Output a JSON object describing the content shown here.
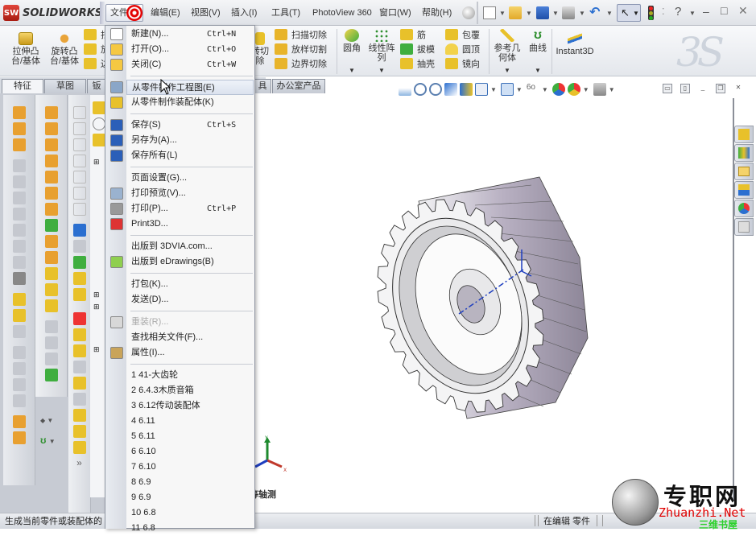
{
  "app": {
    "title": "SOLIDWORKS",
    "logo_badge": "SW"
  },
  "menubar": {
    "items": [
      {
        "id": "file",
        "label": "文件(F)"
      },
      {
        "id": "edit",
        "label": "编辑(E)"
      },
      {
        "id": "view",
        "label": "视图(V)"
      },
      {
        "id": "insert",
        "label": "插入(I)"
      },
      {
        "id": "tools",
        "label": "工具(T)"
      },
      {
        "id": "photoview",
        "label": "PhotoView 360"
      },
      {
        "id": "window",
        "label": "窗口(W)"
      },
      {
        "id": "help",
        "label": "帮助(H)"
      }
    ]
  },
  "quick_toolbar": {
    "icons": [
      "pin-icon",
      "new-document-icon",
      "open-folder-icon",
      "save-icon",
      "print-icon",
      "undo-icon",
      "select-arrow-icon",
      "rebuild-traffic-light-icon",
      "options-icon",
      "help-icon"
    ],
    "window_controls": {
      "minimize": "–",
      "maximize": "□",
      "close": "✕"
    }
  },
  "command_manager": {
    "large_buttons": [
      {
        "label_line1": "拉伸凸",
        "label_line2": "台/基体"
      },
      {
        "label_line1": "旋转凸",
        "label_line2": "台/基体"
      }
    ],
    "small_left": [
      "扫描",
      "放样",
      "边界"
    ],
    "cut_partial": {
      "line1": "转切",
      "line2": "除"
    },
    "cut_group": [
      "扫描切除",
      "放样切割",
      "边界切除"
    ],
    "fillet": "圆角",
    "linear_pattern": {
      "line1": "线性阵",
      "line2": "列"
    },
    "features_a": [
      "筋",
      "拔模",
      "抽壳"
    ],
    "features_b": [
      "包覆",
      "圆顶",
      "镜向"
    ],
    "ref_geometry": {
      "line1": "参考几",
      "line2": "何体"
    },
    "curves": "曲线",
    "instant3d": "Instant3D"
  },
  "tabs": [
    {
      "label": "特征",
      "active": true
    },
    {
      "label": "草图",
      "active": false
    },
    {
      "label": "钣",
      "active": false
    },
    {
      "label": "具",
      "active": false
    },
    {
      "label": "办公室产品",
      "active": false
    }
  ],
  "file_menu": {
    "items": [
      {
        "type": "item",
        "label": "新建(N)...",
        "shortcut": "Ctrl+N",
        "icon": "new-document-icon"
      },
      {
        "type": "item",
        "label": "打开(O)...",
        "shortcut": "Ctrl+O",
        "icon": "open-folder-icon"
      },
      {
        "type": "item",
        "label": "关闭(C)",
        "shortcut": "Ctrl+W",
        "icon": "close-folder-icon"
      },
      {
        "type": "sep"
      },
      {
        "type": "item",
        "label": "从零件制作工程图(E)",
        "shortcut": "",
        "icon": "make-drawing-icon",
        "highlighted": true
      },
      {
        "type": "item",
        "label": "从零件制作装配体(K)",
        "shortcut": "",
        "icon": "make-assembly-icon"
      },
      {
        "type": "sep"
      },
      {
        "type": "item",
        "label": "保存(S)",
        "shortcut": "Ctrl+S",
        "icon": "save-icon"
      },
      {
        "type": "item",
        "label": "另存为(A)...",
        "shortcut": "",
        "icon": "save-as-icon"
      },
      {
        "type": "item",
        "label": "保存所有(L)",
        "shortcut": "",
        "icon": "save-all-icon"
      },
      {
        "type": "sep"
      },
      {
        "type": "item",
        "label": "页面设置(G)...",
        "shortcut": "",
        "icon": ""
      },
      {
        "type": "item",
        "label": "打印预览(V)...",
        "shortcut": "",
        "icon": "print-preview-icon"
      },
      {
        "type": "item",
        "label": "打印(P)...",
        "shortcut": "Ctrl+P",
        "icon": "print-icon"
      },
      {
        "type": "item",
        "label": "Print3D...",
        "shortcut": "",
        "icon": "print3d-icon"
      },
      {
        "type": "sep"
      },
      {
        "type": "item",
        "label": "出版到 3DVIA.com...",
        "shortcut": "",
        "icon": ""
      },
      {
        "type": "item",
        "label": "出版到 eDrawings(B)",
        "shortcut": "",
        "icon": "edrawings-icon"
      },
      {
        "type": "sep"
      },
      {
        "type": "item",
        "label": "打包(K)...",
        "shortcut": "",
        "icon": ""
      },
      {
        "type": "item",
        "label": "发送(D)...",
        "shortcut": "",
        "icon": ""
      },
      {
        "type": "sep"
      },
      {
        "type": "item",
        "label": "重装(R)...",
        "shortcut": "",
        "icon": "reload-icon",
        "disabled": true
      },
      {
        "type": "item",
        "label": "查找相关文件(F)...",
        "shortcut": "",
        "icon": ""
      },
      {
        "type": "item",
        "label": "属性(I)...",
        "shortcut": "",
        "icon": "properties-icon"
      },
      {
        "type": "sep"
      },
      {
        "type": "item",
        "label": "1 41-大齿轮",
        "shortcut": "",
        "icon": ""
      },
      {
        "type": "item",
        "label": "2 6.4.3木质音箱",
        "shortcut": "",
        "icon": ""
      },
      {
        "type": "item",
        "label": "3 6.12传动装配体",
        "shortcut": "",
        "icon": ""
      },
      {
        "type": "item",
        "label": "4 6.11",
        "shortcut": "",
        "icon": ""
      },
      {
        "type": "item",
        "label": "5 6.11",
        "shortcut": "",
        "icon": ""
      },
      {
        "type": "item",
        "label": "6 6.10",
        "shortcut": "",
        "icon": ""
      },
      {
        "type": "item",
        "label": "7 6.10",
        "shortcut": "",
        "icon": ""
      },
      {
        "type": "item",
        "label": "8 6.9",
        "shortcut": "",
        "icon": ""
      },
      {
        "type": "item",
        "label": "9 6.9",
        "shortcut": "",
        "icon": ""
      },
      {
        "type": "item",
        "label": "10 6.8",
        "shortcut": "",
        "icon": ""
      },
      {
        "type": "item",
        "label": "11 6.8",
        "shortcut": "",
        "icon": ""
      }
    ]
  },
  "viewport": {
    "view_name": "等轴测",
    "triad": {
      "x": "X",
      "y": "Y"
    },
    "model": "spur-gear"
  },
  "status_bar": {
    "message": "生成当前零件或装配体的",
    "mode": "在编辑 零件"
  },
  "watermark": {
    "cn": "专职网",
    "en": "Zhuanzhi.Net",
    "sub": "三维书屋"
  },
  "colors": {
    "accent_red": "#e00000",
    "menu_highlight": "#dbe2ee",
    "axis_x": "#c0392b",
    "axis_y": "#1e8a2e",
    "axis_z": "#1f3fbf"
  }
}
